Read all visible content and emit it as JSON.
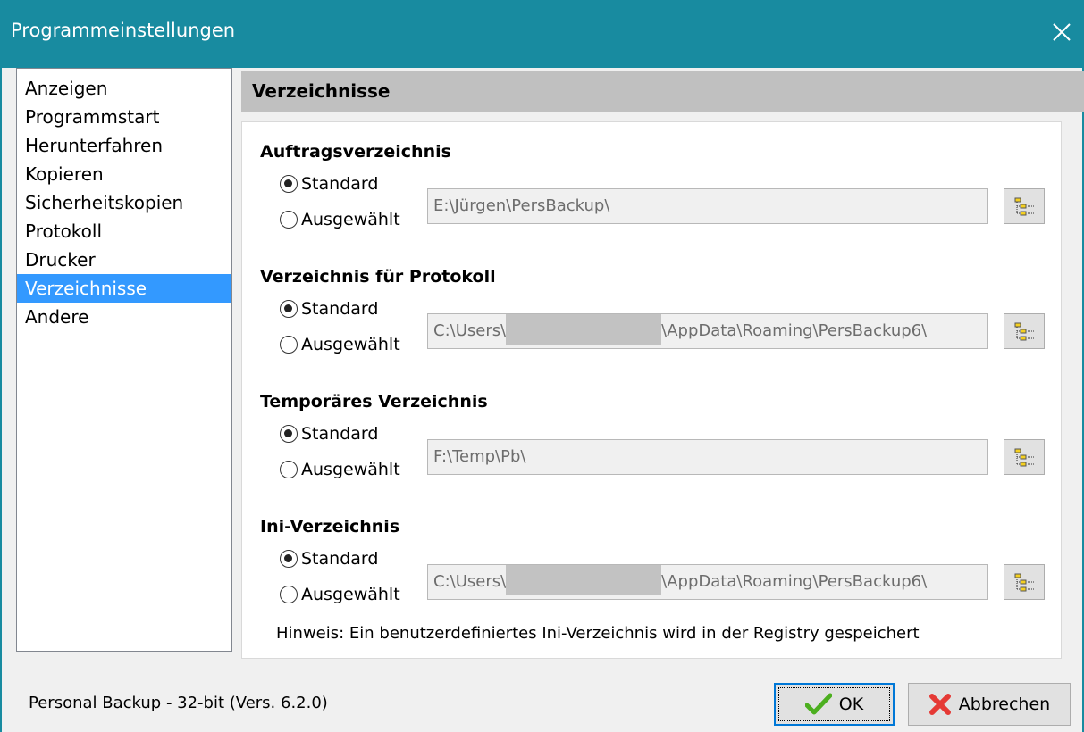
{
  "window": {
    "title": "Programmeinstellungen",
    "close_icon": "close-icon"
  },
  "nav": {
    "items": [
      {
        "label": "Anzeigen",
        "selected": false
      },
      {
        "label": "Programmstart",
        "selected": false
      },
      {
        "label": "Herunterfahren",
        "selected": false
      },
      {
        "label": "Kopieren",
        "selected": false
      },
      {
        "label": "Sicherheitskopien",
        "selected": false
      },
      {
        "label": "Protokoll",
        "selected": false
      },
      {
        "label": "Drucker",
        "selected": false
      },
      {
        "label": "Verzeichnisse",
        "selected": true
      },
      {
        "label": "Andere",
        "selected": false
      }
    ]
  },
  "section": {
    "title": "Verzeichnisse"
  },
  "groups": [
    {
      "title": "Auftragsverzeichnis",
      "option_standard": "Standard",
      "option_selected": "Ausgewählt",
      "checked": "standard",
      "path": "E:\\Jürgen\\PersBackup\\"
    },
    {
      "title": "Verzeichnis für Protokoll",
      "option_standard": "Standard",
      "option_selected": "Ausgewählt",
      "checked": "standard",
      "path_prefix": "C:\\Users\\",
      "path_suffix": "\\AppData\\Roaming\\PersBackup6\\"
    },
    {
      "title": "Temporäres Verzeichnis",
      "option_standard": "Standard",
      "option_selected": "Ausgewählt",
      "checked": "standard",
      "path": "F:\\Temp\\Pb\\"
    },
    {
      "title": "Ini-Verzeichnis",
      "option_standard": "Standard",
      "option_selected": "Ausgewählt",
      "checked": "standard",
      "path_prefix": "C:\\Users\\",
      "path_suffix": "\\AppData\\Roaming\\PersBackup6\\"
    }
  ],
  "hint": "Hinweis: Ein benutzerdefiniertes Ini-Verzeichnis wird in der Registry gespeichert",
  "footer": {
    "version_label": "Personal Backup - 32-bit (Vers. 6.2.0)",
    "ok_label": "OK",
    "cancel_label": "Abbrechen"
  },
  "colors": {
    "titlebar": "#188ba0",
    "selection": "#3399ff",
    "section_header": "#c0c0c0"
  }
}
